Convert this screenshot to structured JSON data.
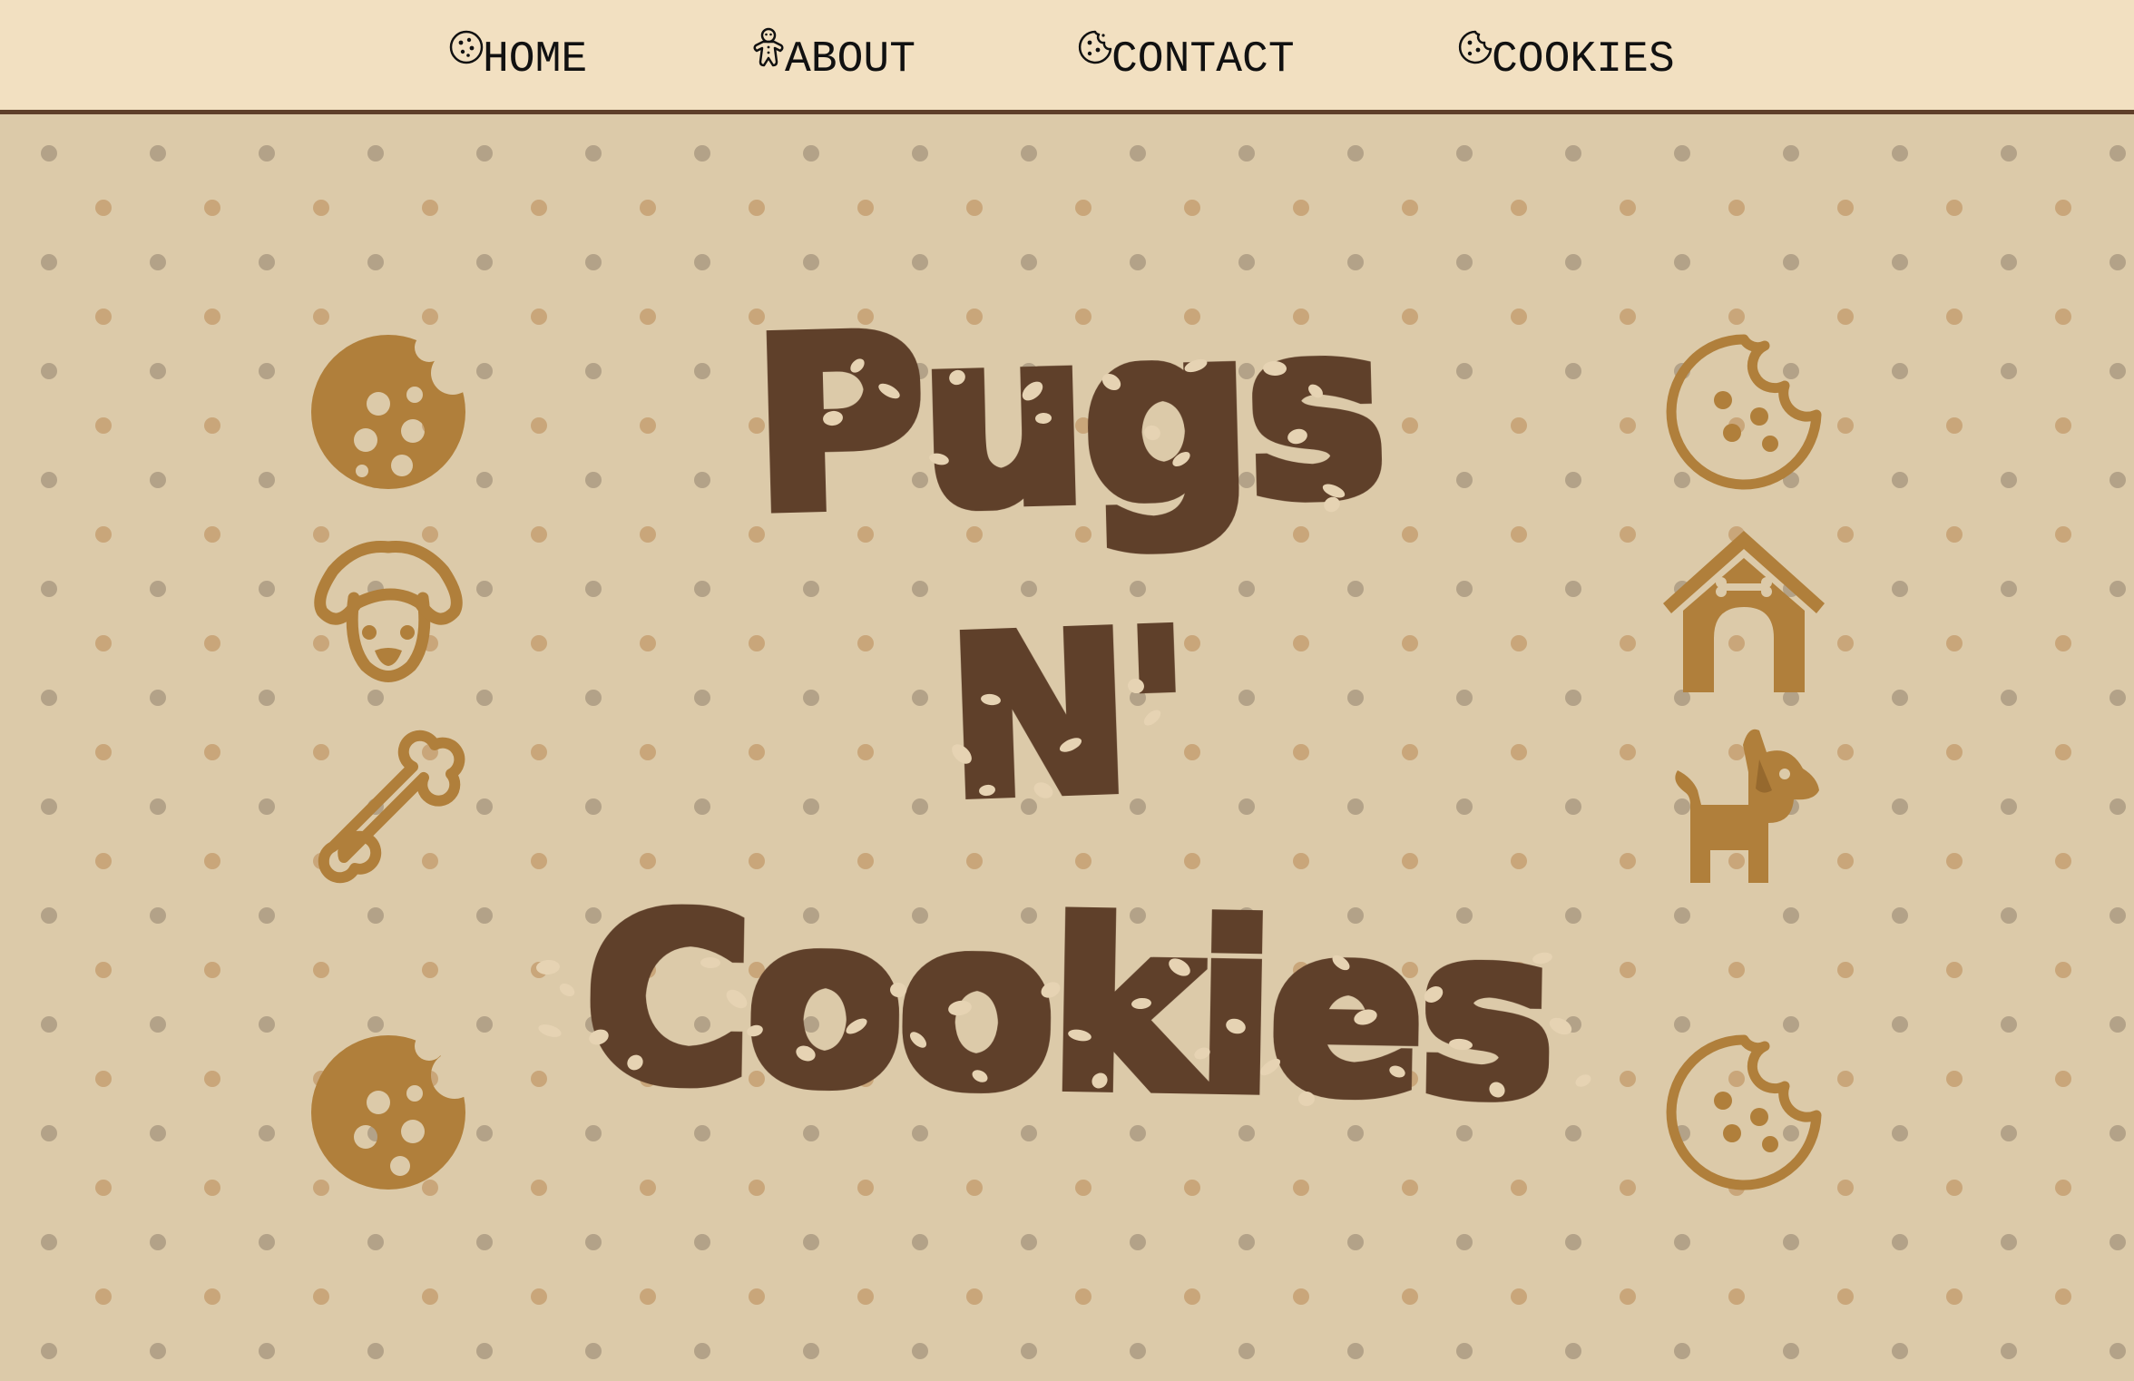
{
  "nav": {
    "items": [
      {
        "label": "HOME",
        "icon": "cookie-icon"
      },
      {
        "label": "ABOUT",
        "icon": "gingerbread-icon"
      },
      {
        "label": "CONTACT",
        "icon": "cookie-bite-icon"
      },
      {
        "label": "COOKIES",
        "icon": "cookie-bite-icon"
      }
    ]
  },
  "hero": {
    "title_line1": "Pugs",
    "title_line2": "N'",
    "title_line3": "Cookies",
    "left_icons": [
      "cookie-bite-solid-icon",
      "dog-face-icon",
      "bone-icon",
      "cookie-bite-solid-icon"
    ],
    "right_icons": [
      "cookie-bite-outline-icon",
      "dog-house-icon",
      "dog-icon",
      "cookie-bite-outline-icon"
    ]
  },
  "colors": {
    "nav_bg": "#f2e0c1",
    "nav_border": "#5f3f2a",
    "page_bg": "#dccaa9",
    "title": "#5f3f2a",
    "icon": "#b07f3b",
    "dot_gray": "#b3a288",
    "dot_tan": "#c9a67a"
  }
}
